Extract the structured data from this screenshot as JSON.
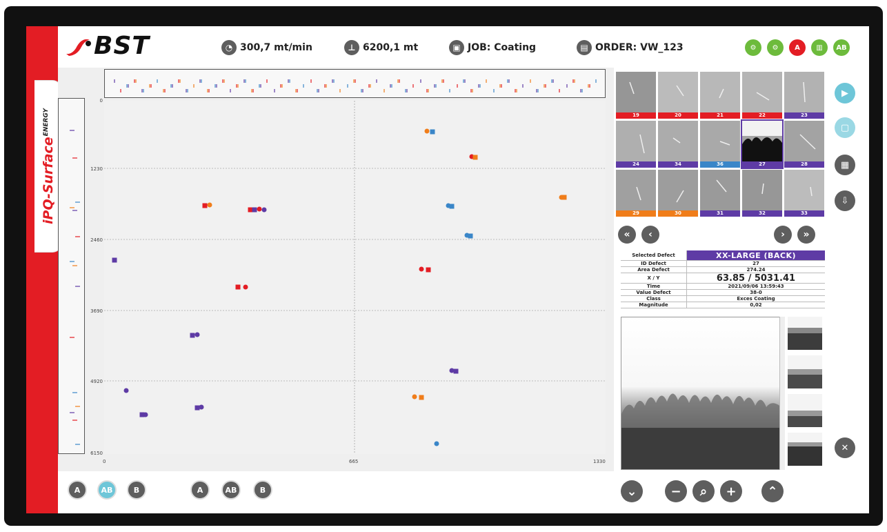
{
  "brand": {
    "logo_text": "BST",
    "product_name": "iPQ-Surface",
    "product_sup": "ENERGY"
  },
  "header": {
    "speed": "300,7 mt/min",
    "length": "6200,1 mt",
    "job": "JOB: Coating",
    "order": "ORDER: VW_123"
  },
  "map": {
    "y_ticks": [
      "0",
      "1230",
      "2460",
      "3690",
      "4920",
      "6150"
    ],
    "x_ticks": [
      "0",
      "665",
      "1330"
    ]
  },
  "thumbnails": [
    {
      "label": "19",
      "color": "#e31d24"
    },
    {
      "label": "20",
      "color": "#e31d24"
    },
    {
      "label": "21",
      "color": "#e31d24"
    },
    {
      "label": "22",
      "color": "#e31d24"
    },
    {
      "label": "23",
      "color": "#5e3ba5"
    },
    {
      "label": "24",
      "color": "#5e3ba5"
    },
    {
      "label": "34",
      "color": "#5e3ba5"
    },
    {
      "label": "36",
      "color": "#3a86c8"
    },
    {
      "label": "27",
      "color": "#5e3ba5"
    },
    {
      "label": "28",
      "color": "#5e3ba5"
    },
    {
      "label": "29",
      "color": "#f07d1a"
    },
    {
      "label": "30",
      "color": "#f07d1a"
    },
    {
      "label": "31",
      "color": "#5e3ba5"
    },
    {
      "label": "32",
      "color": "#5e3ba5"
    },
    {
      "label": "33",
      "color": "#5e3ba5"
    }
  ],
  "defect": {
    "selected_label": "Selected Defect",
    "selected_value": "XX-LARGE (BACK)",
    "id_label": "ID Defect",
    "id_value": "27",
    "area_label": "Area Defect",
    "area_value": "274.24",
    "xy_label": "X / Y",
    "xy_value": "63.85 / 5031.41",
    "time_label": "Time",
    "time_value": "2021/09/06 13:59:43",
    "value_label": "Value Defect",
    "value_value": "38-0",
    "class_label": "Class",
    "class_value": "Exces Coating",
    "magnitude_label": "Magnitude",
    "magnitude_value": "0,02"
  },
  "colors": {
    "red": "#e31d24",
    "purple": "#5e3ba5",
    "blue": "#3a86c8",
    "orange": "#f07d1a",
    "green": "#6dbb3c",
    "grey": "#5e5e5e",
    "teal": "#6ec6d8"
  },
  "toggles": {
    "a": "A",
    "ab": "AB",
    "b": "B"
  },
  "icons": [
    "speedometer-icon",
    "ruler-icon",
    "job-icon",
    "order-icon",
    "play-icon",
    "screen-icon",
    "calendar-icon",
    "file-download-icon",
    "tools-icon"
  ]
}
